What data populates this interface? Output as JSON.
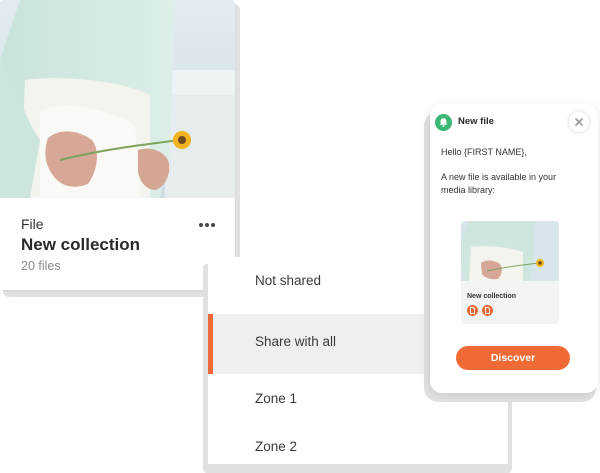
{
  "card": {
    "type_label": "File",
    "title": "New collection",
    "count": "20 files",
    "more_icon": "more-horizontal-icon"
  },
  "share_menu": {
    "items": [
      {
        "label": "Not shared",
        "selected": false
      },
      {
        "label": "Share with all",
        "selected": true
      },
      {
        "label": "Zone 1",
        "selected": false
      },
      {
        "label": "Zone 2",
        "selected": false
      }
    ]
  },
  "notification": {
    "icon": "bell-icon",
    "title": "New file",
    "greeting": "Hello {FIRST NAME},",
    "body": "A new file is available in your media library:",
    "close_icon": "close-icon",
    "preview": {
      "title": "New collection",
      "file_icons": [
        "document-icon",
        "document-icon"
      ]
    },
    "action_label": "Discover"
  },
  "colors": {
    "accent": "#f06a35",
    "success": "#3bb873",
    "selected_background": "#eeeff1",
    "shadow": "#dfe1e3"
  }
}
